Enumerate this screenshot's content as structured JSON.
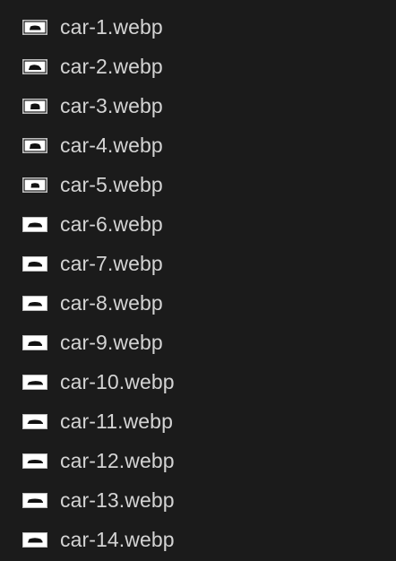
{
  "file_list": {
    "items": [
      {
        "name": "car-1.webp",
        "icon": "image-thumbnail-icon"
      },
      {
        "name": "car-2.webp",
        "icon": "image-thumbnail-icon"
      },
      {
        "name": "car-3.webp",
        "icon": "image-thumbnail-icon"
      },
      {
        "name": "car-4.webp",
        "icon": "image-thumbnail-icon"
      },
      {
        "name": "car-5.webp",
        "icon": "image-thumbnail-icon"
      },
      {
        "name": "car-6.webp",
        "icon": "image-thumbnail-icon"
      },
      {
        "name": "car-7.webp",
        "icon": "image-thumbnail-icon"
      },
      {
        "name": "car-8.webp",
        "icon": "image-thumbnail-icon"
      },
      {
        "name": "car-9.webp",
        "icon": "image-thumbnail-icon"
      },
      {
        "name": "car-10.webp",
        "icon": "image-thumbnail-icon"
      },
      {
        "name": "car-11.webp",
        "icon": "image-thumbnail-icon"
      },
      {
        "name": "car-12.webp",
        "icon": "image-thumbnail-icon"
      },
      {
        "name": "car-13.webp",
        "icon": "image-thumbnail-icon"
      },
      {
        "name": "car-14.webp",
        "icon": "image-thumbnail-icon"
      }
    ]
  },
  "colors": {
    "background": "#1b1b1b",
    "text": "#d4d4d4",
    "thumbnail_frame": "#ffffff",
    "thumbnail_subject": "#111111"
  }
}
